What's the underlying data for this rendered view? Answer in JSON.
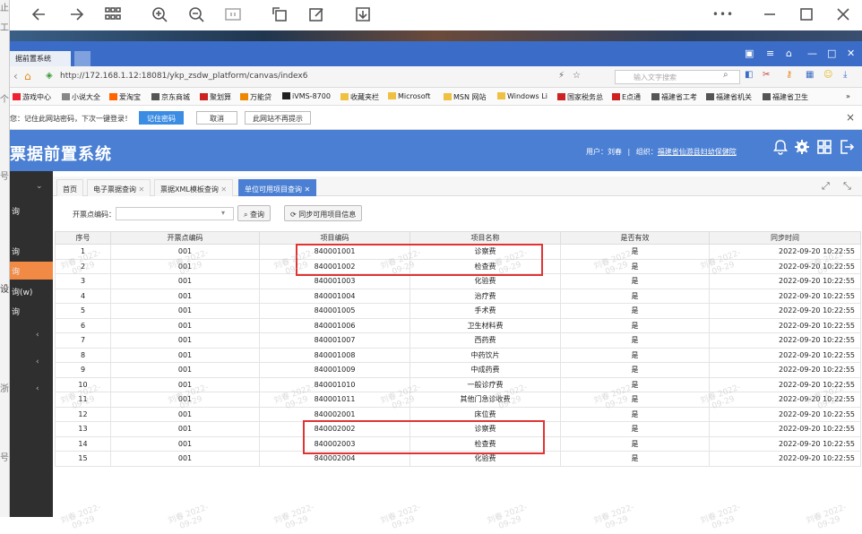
{
  "viewer_toolbar": {
    "icons": [
      "back-arrow-icon",
      "forward-arrow-icon",
      "grid-icon",
      "zoom-in-icon",
      "zoom-out-icon",
      "fit-icon",
      "rotate-icon",
      "edit-icon",
      "download-icon",
      "more-icon",
      "minimize-icon",
      "maximize-icon",
      "close-icon"
    ],
    "more_label": "•••"
  },
  "left_sliver": [
    "止",
    "工",
    "个",
    "号",
    "设",
    "浙",
    "号"
  ],
  "browser": {
    "tab_title": "据前置系统",
    "url": "http://172.168.1.12:18081/ykp_zsdw_platform/canvas/index6",
    "search_placeholder": "输入文字搜索",
    "bookmarks": [
      "游戏中心",
      "小说大全",
      "爱淘宝",
      "京东商城",
      "聚划算",
      "万能贷",
      "iVMS-8700",
      "收藏夹栏",
      "Microsoft",
      "MSN 网站",
      "Windows Li",
      "国家税务总",
      "E点通",
      "福建省工考",
      "福建省机关",
      "福建省卫生",
      "»"
    ],
    "password_bar": {
      "text": "您：记住此网站密码，下次一键登录！",
      "save": "记住密码",
      "cancel": "取消",
      "never": "此网站不再提示",
      "close": "×"
    }
  },
  "app": {
    "title": "票据前置系统",
    "user_label": "用户：刘春",
    "org_label": "组织：",
    "org_name": "福建省仙游县妇幼保健院",
    "separator": "|"
  },
  "sidebar": {
    "items": [
      {
        "label": "询",
        "active": false
      },
      {
        "label": "",
        "active": false
      },
      {
        "label": "询",
        "active": false
      },
      {
        "label": "询",
        "active": true
      },
      {
        "label": "询(w)",
        "active": false
      },
      {
        "label": "询",
        "active": false
      }
    ],
    "chevrons": [
      "‹",
      "‹",
      "‹"
    ],
    "top_chevron": "⌄"
  },
  "content_tabs": [
    {
      "label": "首页",
      "closable": false,
      "active": false
    },
    {
      "label": "电子票据查询",
      "closable": true,
      "active": false
    },
    {
      "label": "票据XML模板查询",
      "closable": true,
      "active": false
    },
    {
      "label": "单位可用项目查询",
      "closable": true,
      "active": true
    }
  ],
  "search": {
    "label": "开票点编码：",
    "value": "",
    "query_button": "查询",
    "sync_button": "同步可用项目信息"
  },
  "table": {
    "columns": [
      "序号",
      "开票点编码",
      "项目编码",
      "项目名称",
      "是否有效",
      "同步时间"
    ],
    "rows": [
      [
        "1",
        "001",
        "840001001",
        "诊察费",
        "是",
        "2022-09-20 10:22:55"
      ],
      [
        "2",
        "001",
        "840001002",
        "检查费",
        "是",
        "2022-09-20 10:22:55"
      ],
      [
        "3",
        "001",
        "840001003",
        "化验费",
        "是",
        "2022-09-20 10:22:55"
      ],
      [
        "4",
        "001",
        "840001004",
        "治疗费",
        "是",
        "2022-09-20 10:22:55"
      ],
      [
        "5",
        "001",
        "840001005",
        "手术费",
        "是",
        "2022-09-20 10:22:55"
      ],
      [
        "6",
        "001",
        "840001006",
        "卫生材料费",
        "是",
        "2022-09-20 10:22:55"
      ],
      [
        "7",
        "001",
        "840001007",
        "西药费",
        "是",
        "2022-09-20 10:22:55"
      ],
      [
        "8",
        "001",
        "840001008",
        "中药饮片",
        "是",
        "2022-09-20 10:22:55"
      ],
      [
        "9",
        "001",
        "840001009",
        "中成药费",
        "是",
        "2022-09-20 10:22:55"
      ],
      [
        "10",
        "001",
        "840001010",
        "一般诊疗费",
        "是",
        "2022-09-20 10:22:55"
      ],
      [
        "11",
        "001",
        "840001011",
        "其他门急诊收费",
        "是",
        "2022-09-20 10:22:55"
      ],
      [
        "12",
        "001",
        "840002001",
        "床位费",
        "是",
        "2022-09-20 10:22:55"
      ],
      [
        "13",
        "001",
        "840002002",
        "诊察费",
        "是",
        "2022-09-20 10:22:55"
      ],
      [
        "14",
        "001",
        "840002003",
        "检查费",
        "是",
        "2022-09-20 10:22:55"
      ],
      [
        "15",
        "001",
        "840002004",
        "化验费",
        "是",
        "2022-09-20 10:22:55"
      ]
    ]
  },
  "watermark": {
    "line1": "刘春 2022-",
    "line2": "09-29"
  },
  "colors": {
    "header_blue": "#4a7fd3",
    "active_orange": "#f08a44",
    "sidebar_dark": "#2f2f2f",
    "highlight_red": "#e03434"
  }
}
